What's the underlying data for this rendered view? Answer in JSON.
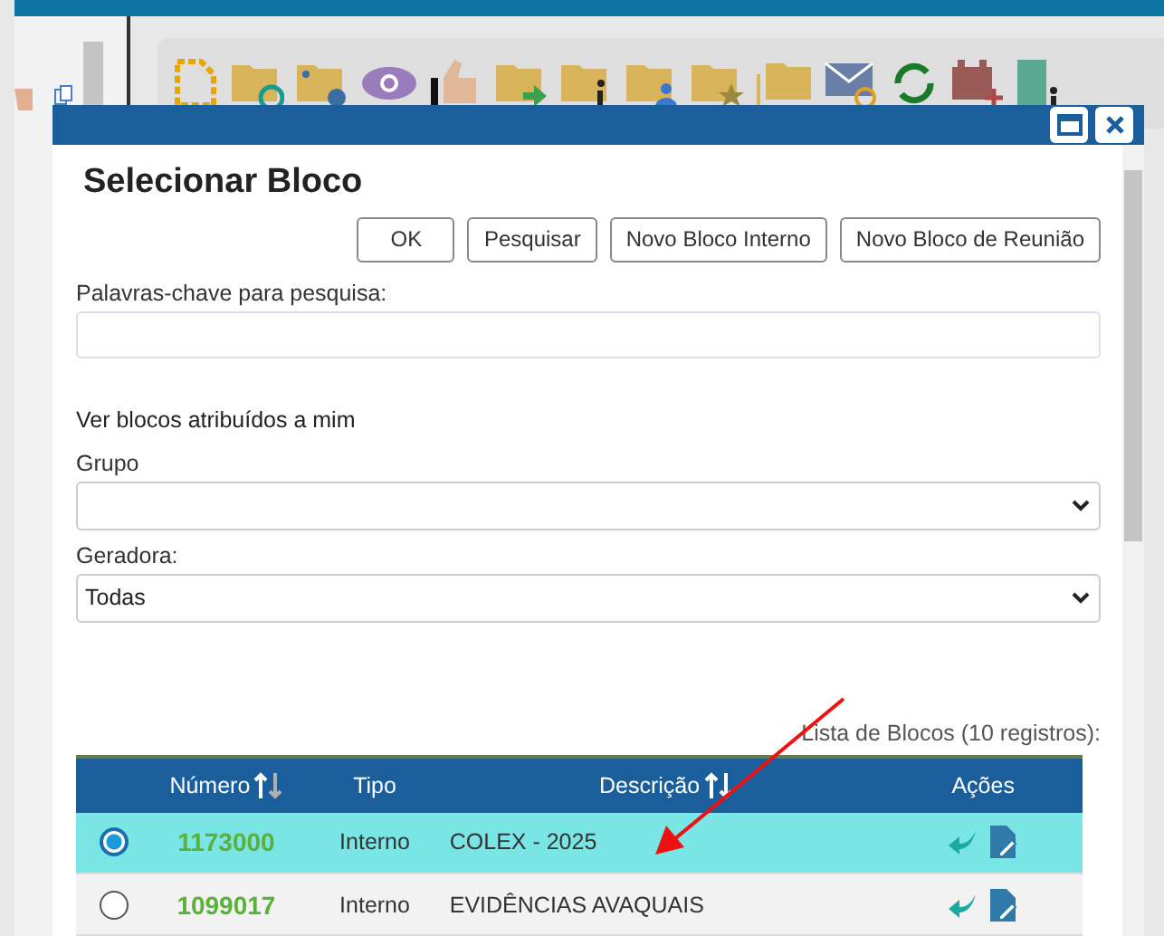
{
  "dialog": {
    "title": "Selecionar Bloco",
    "buttons": [
      "OK",
      "Pesquisar",
      "Novo Bloco Interno",
      "Novo Bloco de Reunião"
    ],
    "keywords": {
      "label": "Palavras-chave para pesquisa:"
    },
    "assigned_link": "Ver blocos atribuídos a mim",
    "grupo": {
      "label": "Grupo"
    },
    "geradora": {
      "label": "Geradora:",
      "value": "Todas"
    },
    "table": {
      "caption": "Lista de Blocos (10 registros):",
      "columns": [
        "Número",
        "Tipo",
        "Descrição",
        "Ações"
      ],
      "rows": [
        {
          "selected": true,
          "numero": "1173000",
          "tipo": "Interno",
          "descricao": "COLEX - 2025"
        },
        {
          "selected": false,
          "numero": "1099017",
          "tipo": "Interno",
          "descricao": "EVIDÊNCIAS AVAQUAIS"
        }
      ]
    }
  }
}
